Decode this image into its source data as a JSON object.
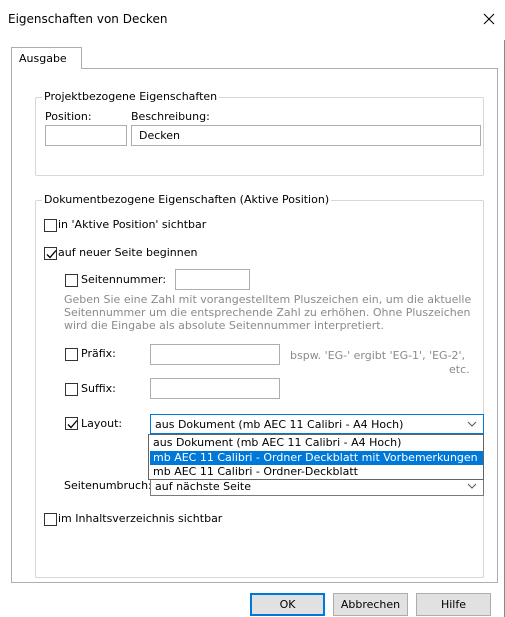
{
  "window": {
    "title": "Eigenschaften von Decken"
  },
  "tabs": [
    {
      "label": "Ausgabe"
    }
  ],
  "project_group": {
    "legend": "Projektbezogene Eigenschaften",
    "position_label": "Position:",
    "position_value": "",
    "description_label": "Beschreibung:",
    "description_value": "Decken"
  },
  "document_group": {
    "legend": "Dokumentbezogene Eigenschaften (Aktive Position)",
    "visible_active_label": "in 'Aktive Position' sichtbar",
    "visible_active_checked": false,
    "new_page_label": "auf neuer Seite beginnen",
    "new_page_checked": true,
    "page_number_label": "Seitennummer:",
    "page_number_checked": false,
    "page_number_value": "",
    "help_line1": "Geben Sie eine Zahl mit vorangestelltem Pluszeichen ein, um die aktuelle",
    "help_line2": "Seitennummer um die entsprechende Zahl zu erhöhen. Ohne Pluszeichen",
    "help_line3": "wird die Eingabe als absolute Seitennummer interpretiert.",
    "prefix_label": "Präfix:",
    "prefix_checked": false,
    "prefix_value": "",
    "prefix_hint_line1": "bspw. 'EG-' ergibt 'EG-1',  'EG-2',",
    "prefix_hint_line2": "etc.",
    "suffix_label": "Suffix:",
    "suffix_checked": false,
    "suffix_value": "",
    "layout_label": "Layout:",
    "layout_checked": true,
    "layout_value": "aus Dokument (mb AEC 11 Calibri - A4 Hoch)",
    "layout_options": [
      "aus Dokument (mb AEC 11 Calibri - A4 Hoch)",
      "mb AEC 11 Calibri - Ordner Deckblatt mit Vorbemerkungen",
      "mb AEC 11 Calibri - Ordner-Deckblatt"
    ],
    "layout_highlighted_index": 1,
    "page_break_label": "Seitenumbruch:",
    "page_break_value": "auf nächste Seite",
    "toc_label": "im Inhaltsverzeichnis sichtbar",
    "toc_checked": false
  },
  "buttons": {
    "ok": "OK",
    "cancel": "Abbrechen",
    "help": "Hilfe"
  },
  "colors": {
    "accent": "#0078d7",
    "border": "#adadad",
    "disabled_text": "#8a8a8a"
  }
}
